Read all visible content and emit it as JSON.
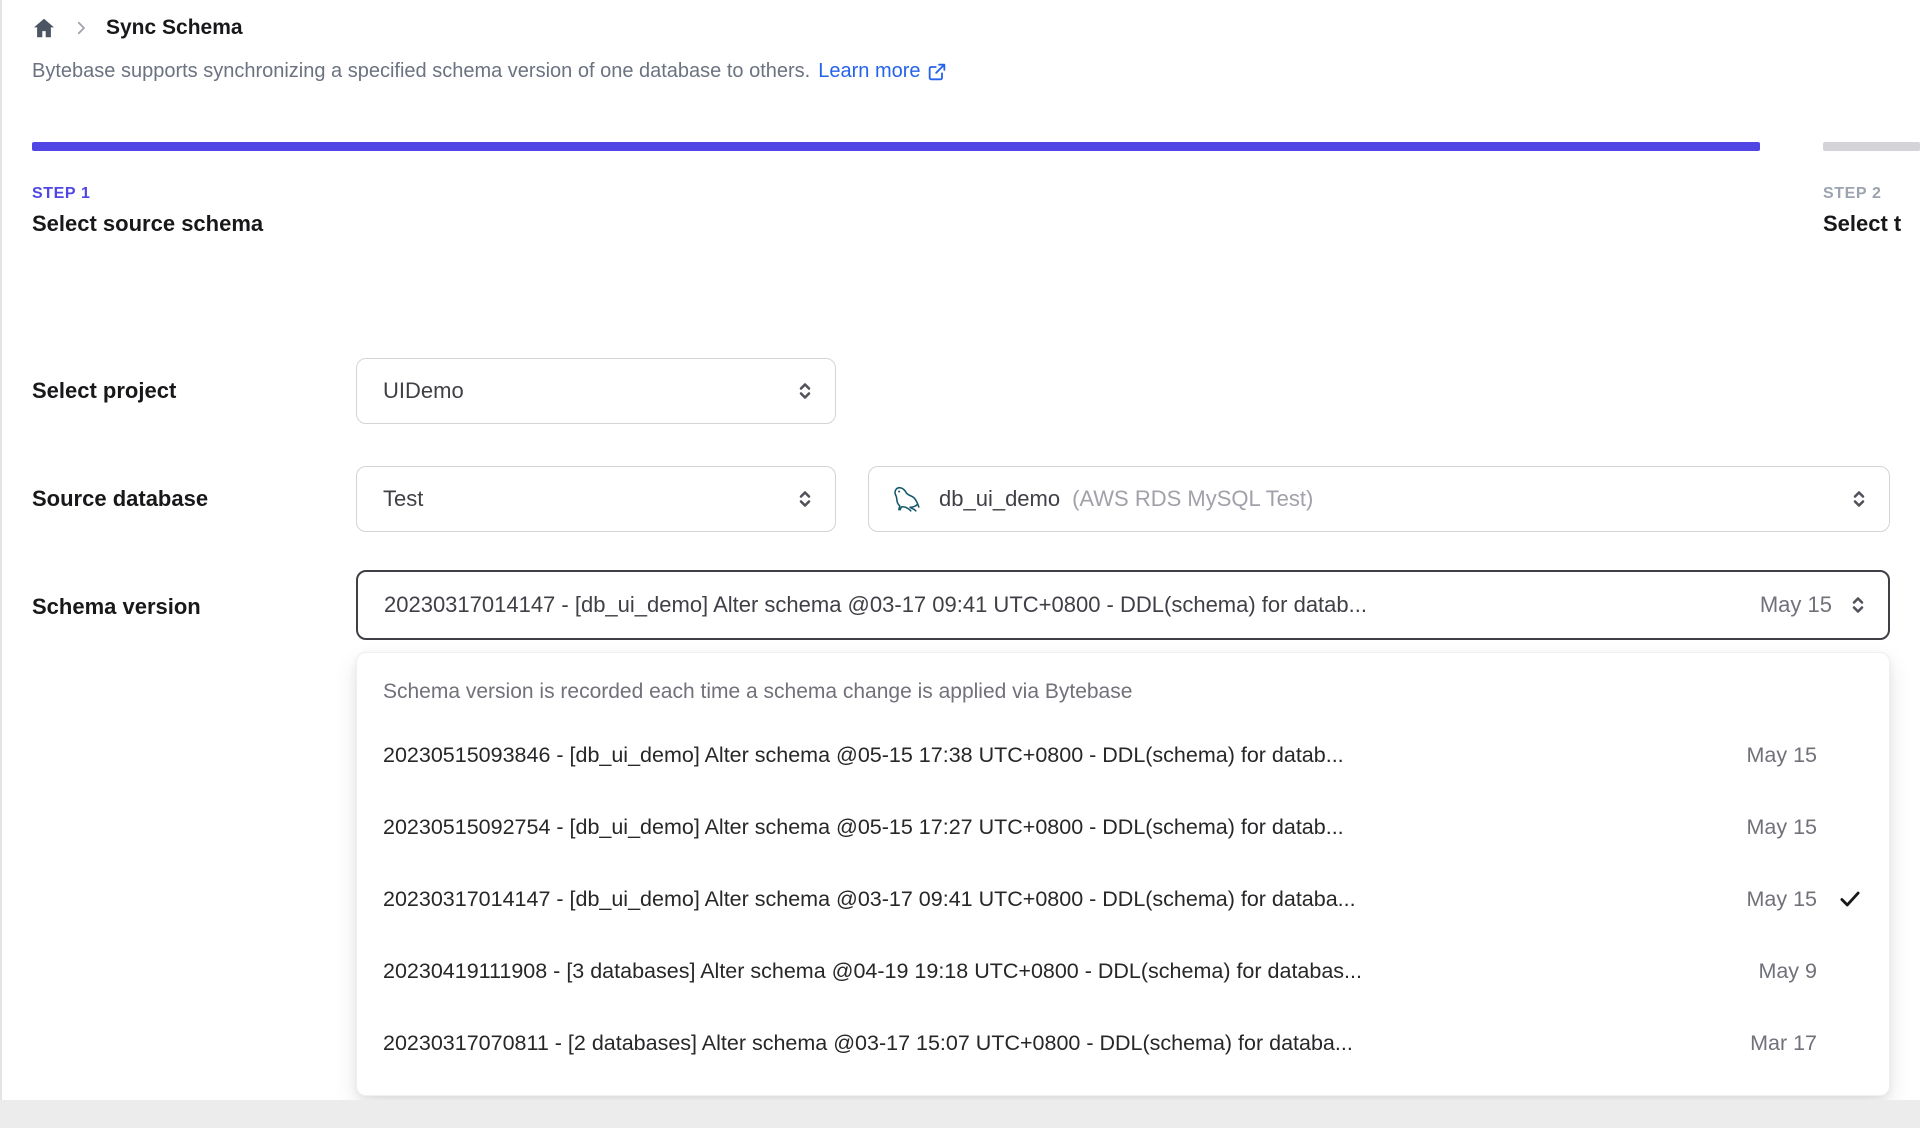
{
  "breadcrumb": {
    "page_title": "Sync Schema"
  },
  "intro": {
    "text": "Bytebase supports synchronizing a specified schema version of one database to others.",
    "link_label": "Learn more"
  },
  "steps": [
    {
      "label": "STEP 1",
      "title": "Select source schema",
      "active": true
    },
    {
      "label": "STEP 2",
      "title": "Select t",
      "active": false
    }
  ],
  "form": {
    "project": {
      "label": "Select project",
      "value": "UIDemo"
    },
    "source_database": {
      "label": "Source database",
      "environment_value": "Test",
      "database_name": "db_ui_demo",
      "database_note": "(AWS RDS MySQL Test)"
    },
    "schema_version": {
      "label": "Schema version",
      "value": "20230317014147 - [db_ui_demo] Alter schema @03-17 09:41 UTC+0800 - DDL(schema) for datab...",
      "value_date": "May 15"
    }
  },
  "dropdown": {
    "hint": "Schema version is recorded each time a schema change is applied via Bytebase",
    "options": [
      {
        "text": "20230515093846 - [db_ui_demo] Alter schema @05-15 17:38 UTC+0800 - DDL(schema) for datab...",
        "date": "May 15",
        "selected": false
      },
      {
        "text": "20230515092754 - [db_ui_demo] Alter schema @05-15 17:27 UTC+0800 - DDL(schema) for datab...",
        "date": "May 15",
        "selected": false
      },
      {
        "text": "20230317014147 - [db_ui_demo] Alter schema @03-17 09:41 UTC+0800 - DDL(schema) for databa...",
        "date": "May 15",
        "selected": true
      },
      {
        "text": "20230419111908 - [3 databases] Alter schema @04-19 19:18 UTC+0800 - DDL(schema) for databas...",
        "date": "May 9",
        "selected": false
      },
      {
        "text": "20230317070811 - [2 databases] Alter schema @03-17 15:07 UTC+0800 - DDL(schema) for databa...",
        "date": "Mar 17",
        "selected": false
      }
    ]
  },
  "colors": {
    "accent_indigo": "#4f46e5",
    "link_blue": "#2563eb",
    "inactive_bar_gray": "#d4d4d8",
    "focused_border": "#3f3f46",
    "muted_text": "#71717a"
  }
}
